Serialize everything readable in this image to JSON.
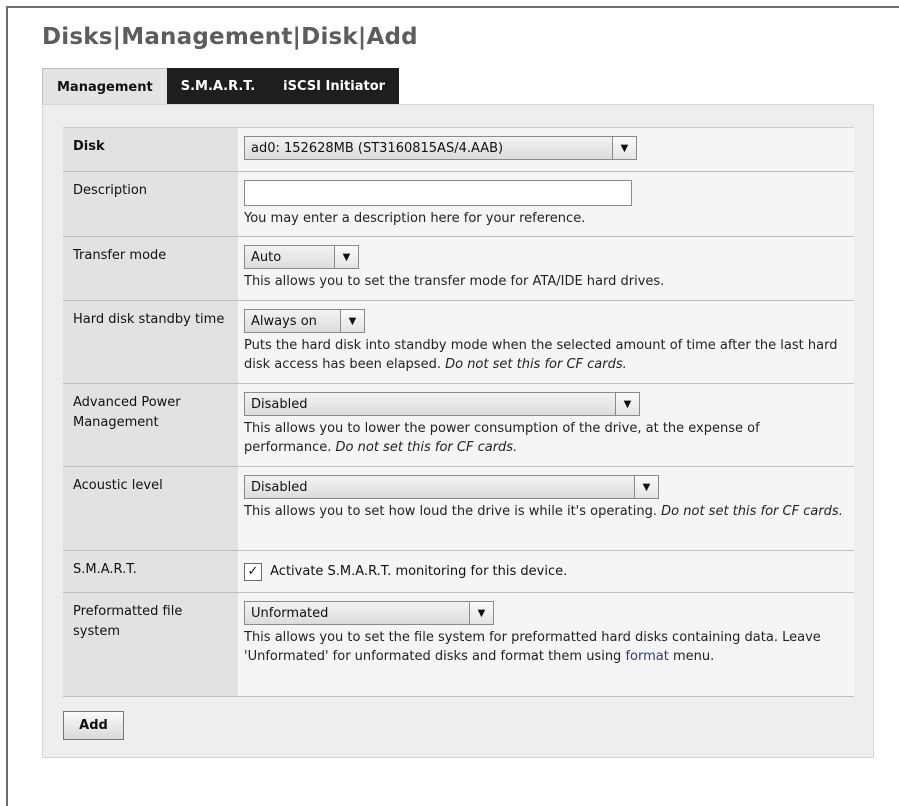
{
  "page": {
    "title": "Disks|Management|Disk|Add"
  },
  "tabs": [
    {
      "label": "Management",
      "active": true
    },
    {
      "label": "S.M.A.R.T.",
      "active": false
    },
    {
      "label": "iSCSI Initiator",
      "active": false
    }
  ],
  "form": {
    "disk": {
      "label": "Disk",
      "value": "ad0: 152628MB (ST3160815AS/4.AAB)"
    },
    "description": {
      "label": "Description",
      "value": "",
      "hint": "You may enter a description here for your reference."
    },
    "transfer_mode": {
      "label": "Transfer mode",
      "value": "Auto",
      "hint": "This allows you to set the transfer mode for ATA/IDE hard drives."
    },
    "standby": {
      "label": "Hard disk standby time",
      "value": "Always on",
      "hint": "Puts the hard disk into standby mode when the selected amount of time after the last hard disk access has been elapsed.",
      "hint_italic": "Do not set this for CF cards."
    },
    "apm": {
      "label": "Advanced Power Management",
      "value": "Disabled",
      "hint": "This allows you to lower the power consumption of the drive, at the expense of performance.",
      "hint_italic": "Do not set this for CF cards."
    },
    "acoustic": {
      "label": "Acoustic level",
      "value": "Disabled",
      "hint": "This allows you to set how loud the drive is while it's operating.",
      "hint_italic": "Do not set this for CF cards."
    },
    "smart": {
      "label": "S.M.A.R.T.",
      "checked": true,
      "check_mark": "✓",
      "checkbox_label": "Activate S.M.A.R.T. monitoring for this device."
    },
    "fs": {
      "label": "Preformatted file system",
      "value": "Unformated",
      "hint_before": "This allows you to set the file system for preformatted hard disks containing data. Leave 'Unformated' for unformated disks and format them using",
      "hint_link": "format",
      "hint_after": "menu."
    }
  },
  "buttons": {
    "add": "Add"
  },
  "icons": {
    "dropdown": "▼"
  },
  "colors": {
    "tab_inactive_bg": "#1e1e1e",
    "link": "#2d3c8a",
    "panel_bg": "#eeeeee"
  }
}
